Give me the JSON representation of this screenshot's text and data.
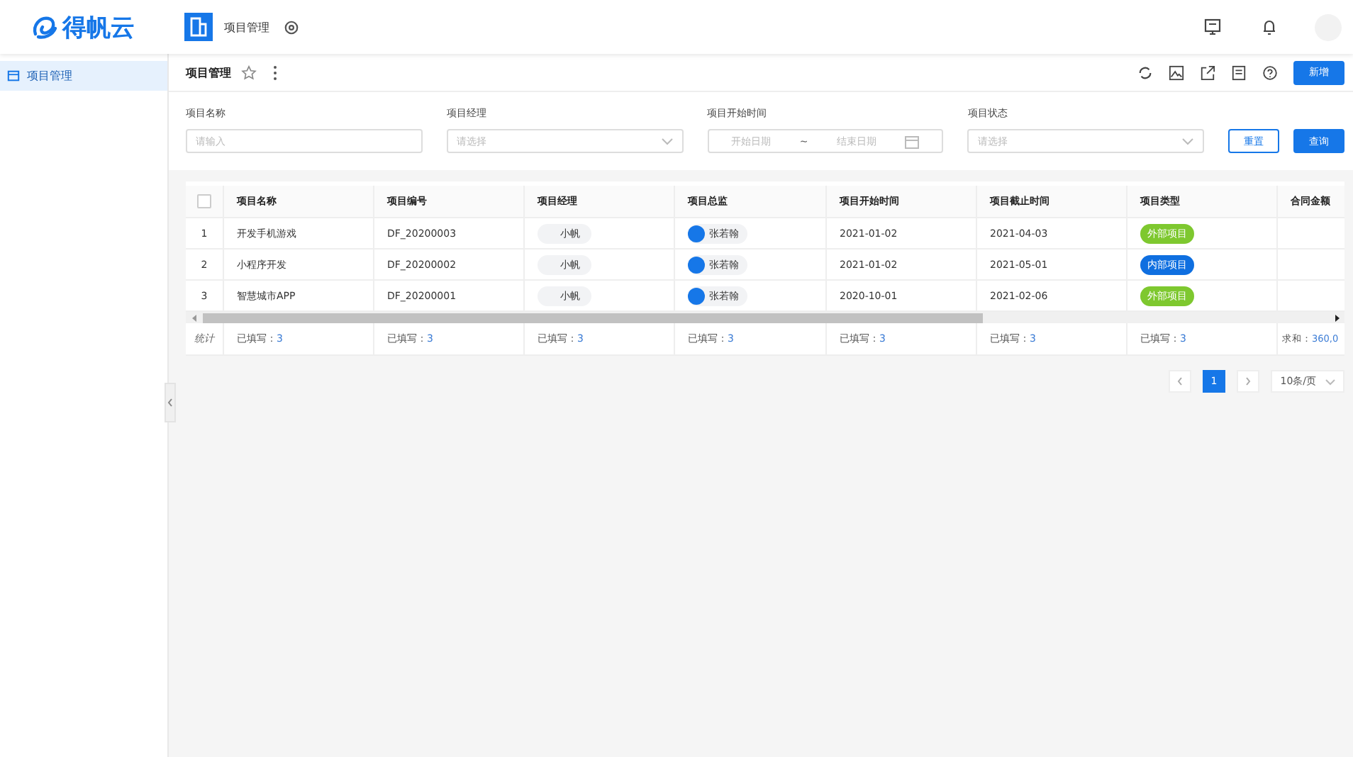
{
  "header": {
    "logo": "得帆云",
    "app_name": "项目管理"
  },
  "sidebar": {
    "items": [
      {
        "label": "项目管理",
        "selected": true
      }
    ]
  },
  "page": {
    "title": "项目管理",
    "new_button": "新增"
  },
  "filters": [
    {
      "label": "项目名称",
      "kind": "input",
      "placeholder": "请输入"
    },
    {
      "label": "项目经理",
      "kind": "select",
      "placeholder": "请选择"
    },
    {
      "label": "项目开始时间",
      "kind": "daterange",
      "placeholder": "开始日期",
      "placeholder_end": "结束日期",
      "separator": "~"
    },
    {
      "label": "项目状态",
      "kind": "select",
      "placeholder": "请选择"
    }
  ],
  "filter_buttons": {
    "reset": "重置",
    "search": "查询"
  },
  "table": {
    "columns": [
      "项目名称",
      "项目编号",
      "项目经理",
      "项目总监",
      "项目开始时间",
      "项目截止时间",
      "项目类型",
      "合同金额"
    ],
    "rows": [
      {
        "index": "1",
        "name": "开发手机游戏",
        "code": "DF_20200003",
        "manager": "小帆",
        "director": "张若翰",
        "start": "2021-01-02",
        "end": "2021-04-03",
        "type": {
          "text": "外部项目",
          "color": "#7ec82f"
        }
      },
      {
        "index": "2",
        "name": "小程序开发",
        "code": "DF_20200002",
        "manager": "小帆",
        "director": "张若翰",
        "start": "2021-01-02",
        "end": "2021-05-01",
        "type": {
          "text": "内部项目",
          "color": "#0f6fe0"
        }
      },
      {
        "index": "3",
        "name": "智慧城市APP",
        "code": "DF_20200001",
        "manager": "小帆",
        "director": "张若翰",
        "start": "2020-10-01",
        "end": "2021-02-06",
        "type": {
          "text": "外部项目",
          "color": "#7ec82f"
        }
      }
    ],
    "footer": {
      "label": "统计",
      "cells": [
        {
          "label": "已填写：",
          "value": "3"
        },
        {
          "label": "已填写：",
          "value": "3"
        },
        {
          "label": "已填写：",
          "value": "3"
        },
        {
          "label": "已填写：",
          "value": "3"
        },
        {
          "label": "已填写：",
          "value": "3"
        },
        {
          "label": "已填写：",
          "value": "3"
        },
        {
          "label": "已填写：",
          "value": "3"
        },
        {
          "label": "求和：",
          "value": "360,0"
        }
      ]
    },
    "select_all": {
      "checked": false
    }
  },
  "pagination": {
    "pages": [
      {
        "label": "1",
        "selected": true
      }
    ],
    "page_size": "10条/页"
  }
}
